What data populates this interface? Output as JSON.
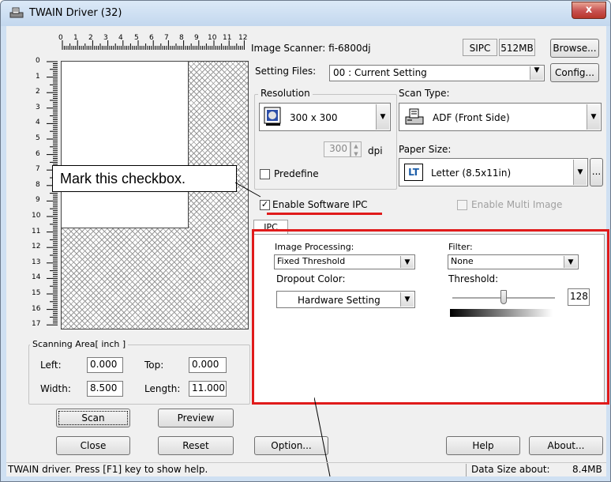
{
  "window": {
    "title": "TWAIN Driver (32)",
    "close_label": "x"
  },
  "ruler": {
    "top_numbers": [
      "0",
      "1",
      "2",
      "3",
      "4",
      "5",
      "6",
      "7",
      "8",
      "9",
      "10",
      "11",
      "12"
    ],
    "left_numbers": [
      "0",
      "1",
      "2",
      "3",
      "4",
      "5",
      "6",
      "7",
      "8",
      "9",
      "10",
      "11",
      "12",
      "13",
      "14",
      "15",
      "16",
      "17"
    ]
  },
  "scanner": {
    "label": "Image Scanner:",
    "model": "fi-6800dj",
    "sipc": "SIPC",
    "memory": "512MB",
    "browse_label": "Browse..."
  },
  "setting_files": {
    "label": "Setting Files:",
    "value": "00 : Current Setting",
    "config_label": "Config..."
  },
  "resolution": {
    "group_label": "Resolution",
    "value": "300 x 300",
    "dpi_value": "300",
    "dpi_unit": "dpi",
    "predefine_label": "Predefine"
  },
  "scan_type": {
    "label": "Scan Type:",
    "value": "ADF (Front Side)"
  },
  "paper_size": {
    "label": "Paper Size:",
    "icon_text": "LT",
    "value": "Letter (8.5x11in)",
    "more_label": "..."
  },
  "enable_software_ipc": {
    "label": "Enable Software IPC",
    "checked": true
  },
  "enable_multi_image": {
    "label": "Enable Multi Image",
    "checked": false
  },
  "ipc_tab": {
    "tab_label": "IPC",
    "image_processing_label": "Image Processing:",
    "image_processing_value": "Fixed Threshold",
    "dropout_label": "Dropout Color:",
    "dropout_value": "Hardware Setting",
    "filter_label": "Filter:",
    "filter_value": "None",
    "threshold_label": "Threshold:",
    "threshold_value": "128"
  },
  "scanning_area": {
    "group_label": "Scanning Area[ inch ]",
    "left_label": "Left:",
    "left_value": "0.000",
    "top_label": "Top:",
    "top_value": "0.000",
    "width_label": "Width:",
    "width_value": "8.500",
    "length_label": "Length:",
    "length_value": "11.000"
  },
  "buttons": {
    "scan": "Scan",
    "preview": "Preview",
    "close": "Close",
    "reset": "Reset",
    "option": "Option...",
    "help": "Help",
    "about": "About..."
  },
  "status": {
    "help_text": "TWAIN driver. Press [F1] key to show help.",
    "data_size_label": "Data Size about:",
    "data_size_value": "8.4MB"
  },
  "annotation": {
    "callout_text": "Mark this checkbox.",
    "accent_color": "#e01b1b"
  }
}
